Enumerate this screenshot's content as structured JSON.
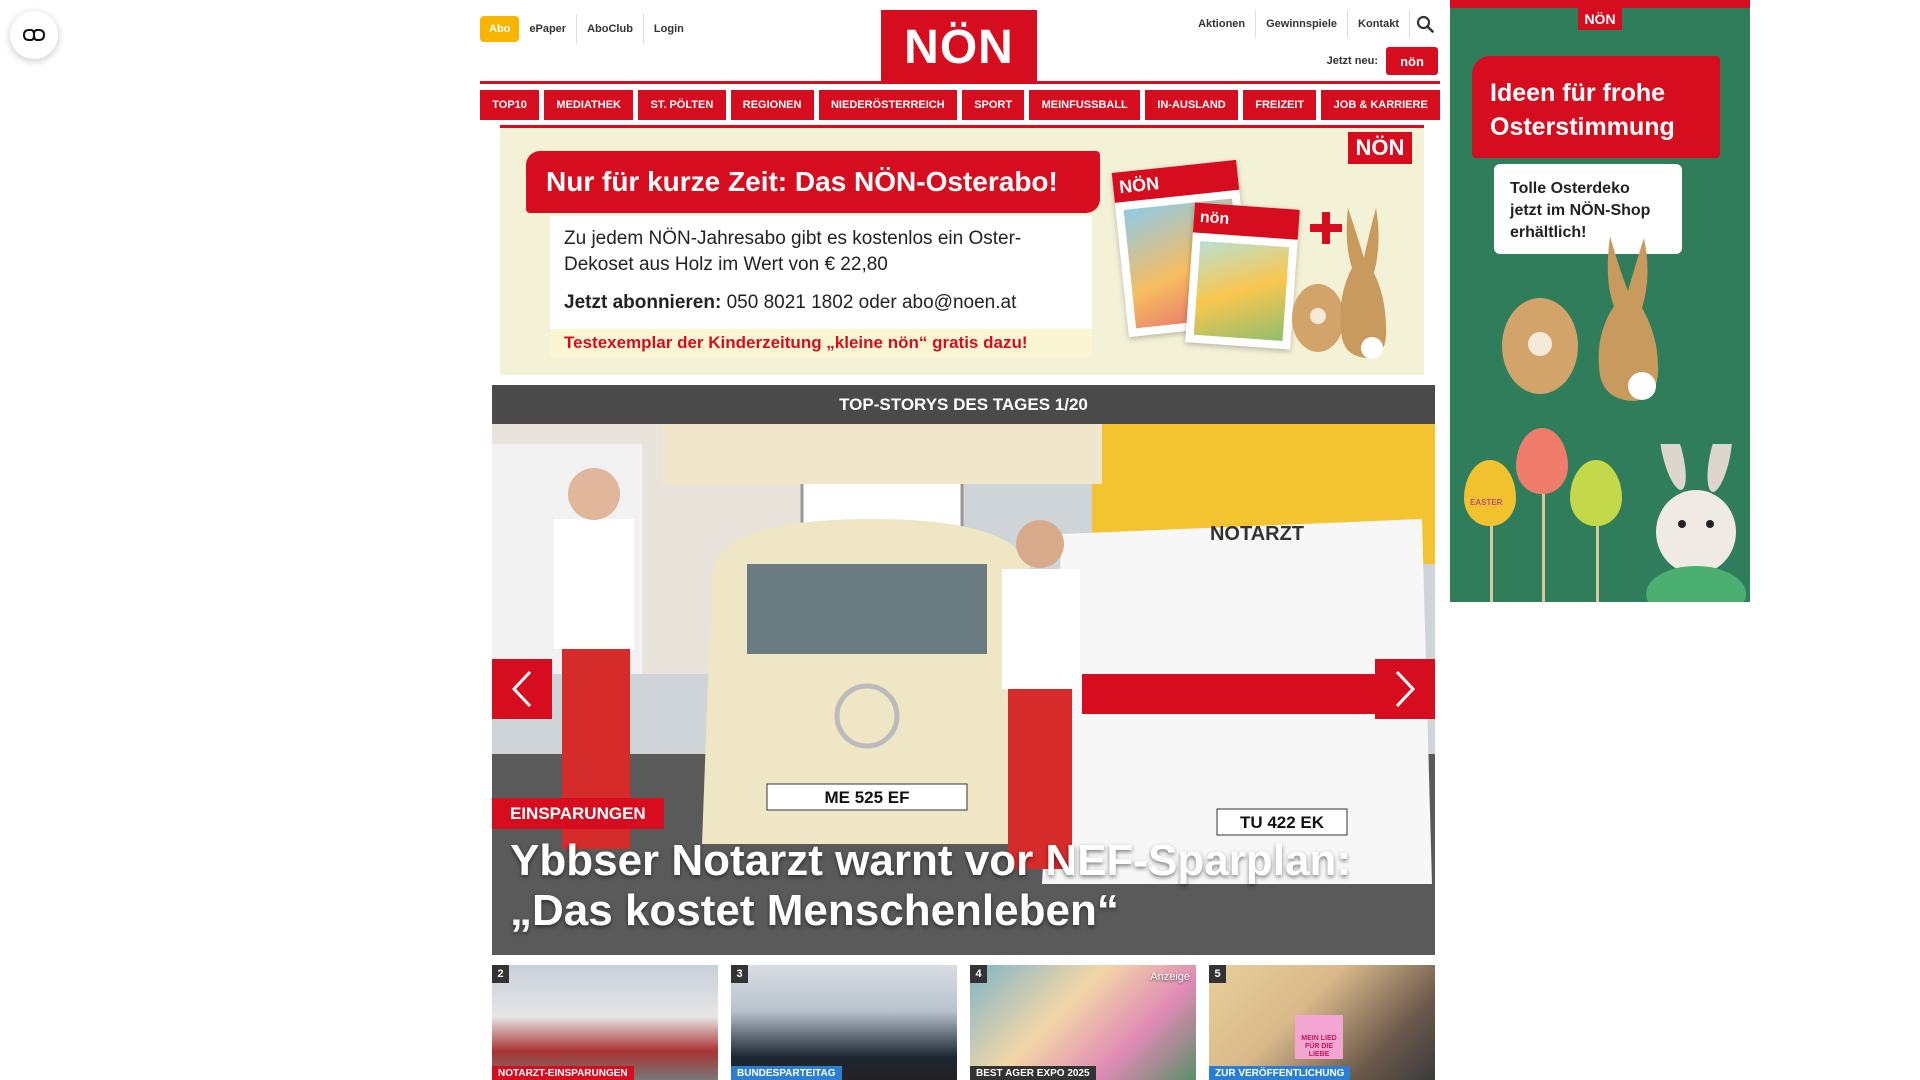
{
  "colors": {
    "brand_red": "#d60d1f",
    "abo_yellow": "#f7b500",
    "ad_green": "#2f7d5a"
  },
  "a11y": {
    "icon": "glasses-icon"
  },
  "header": {
    "abo": "Abo",
    "top_links": [
      "ePaper",
      "AboClub",
      "Login"
    ],
    "logo": "NÖN",
    "right_links": [
      "Aktionen",
      "Gewinnspiele",
      "Kontakt"
    ],
    "search_icon": "search-icon",
    "jetzt_neu": "Jetzt neu:",
    "kleine_logo": "nön"
  },
  "nav": [
    "TOP10",
    "MEDIATHEK",
    "ST. PÖLTEN",
    "REGIONEN",
    "NIEDERÖSTERREICH",
    "SPORT",
    "MEINFUSSBALL",
    "IN-AUSLAND",
    "FREIZEIT",
    "JOB & KARRIERE"
  ],
  "promo": {
    "title": "Nur für kurze Zeit: Das NÖN-Osterabo!",
    "desc": "Zu jedem NÖN-Jahresabo gibt es kostenlos ein Oster-Dekoset aus Holz im Wert von € 22,80",
    "phone_label": "Jetzt abonnieren:",
    "phone_text": "050 8021 1802 oder abo@noen.at",
    "test": "Testexemplar der Kinderzeitung „kleine nön“ gratis dazu!",
    "logo": "NÖN",
    "mag_label_1": "NÖN",
    "mag_label_2": "nön"
  },
  "slider": {
    "head": "TOP-STORYS DES TAGES 1/20",
    "kicker": "EINSPARUNGEN",
    "headline": "Ybbser Notarzt warnt vor NEF-Sparplan: „Das kostet Menschenleben“",
    "sign": "NOTARZT",
    "plate_1": "ME 525 EF",
    "plate_2": "TU 422 EK"
  },
  "thumbs": [
    {
      "num": "2",
      "caption": "NOTARZT-EINSPARUNGEN",
      "cap_color": "#d60d1f"
    },
    {
      "num": "3",
      "caption": "BUNDESPARTEITAG",
      "cap_color": "#2a7fd4"
    },
    {
      "num": "4",
      "caption": "BEST AGER EXPO 2025",
      "cap_color": "#333333",
      "badge": "Anzeige"
    },
    {
      "num": "5",
      "caption": "ZUR VERÖFFENTLICHUNG",
      "cap_color": "#2a7fd4",
      "sign": "MEIN LIED FÜR DIE LIEBE"
    }
  ],
  "side_ad": {
    "logo": "NÖN",
    "title": "Ideen für frohe Osterstimmung",
    "sub": "Tolle Osterdeko jetzt im NÖN-Shop erhältlich!",
    "egg_label": "EASTER"
  }
}
